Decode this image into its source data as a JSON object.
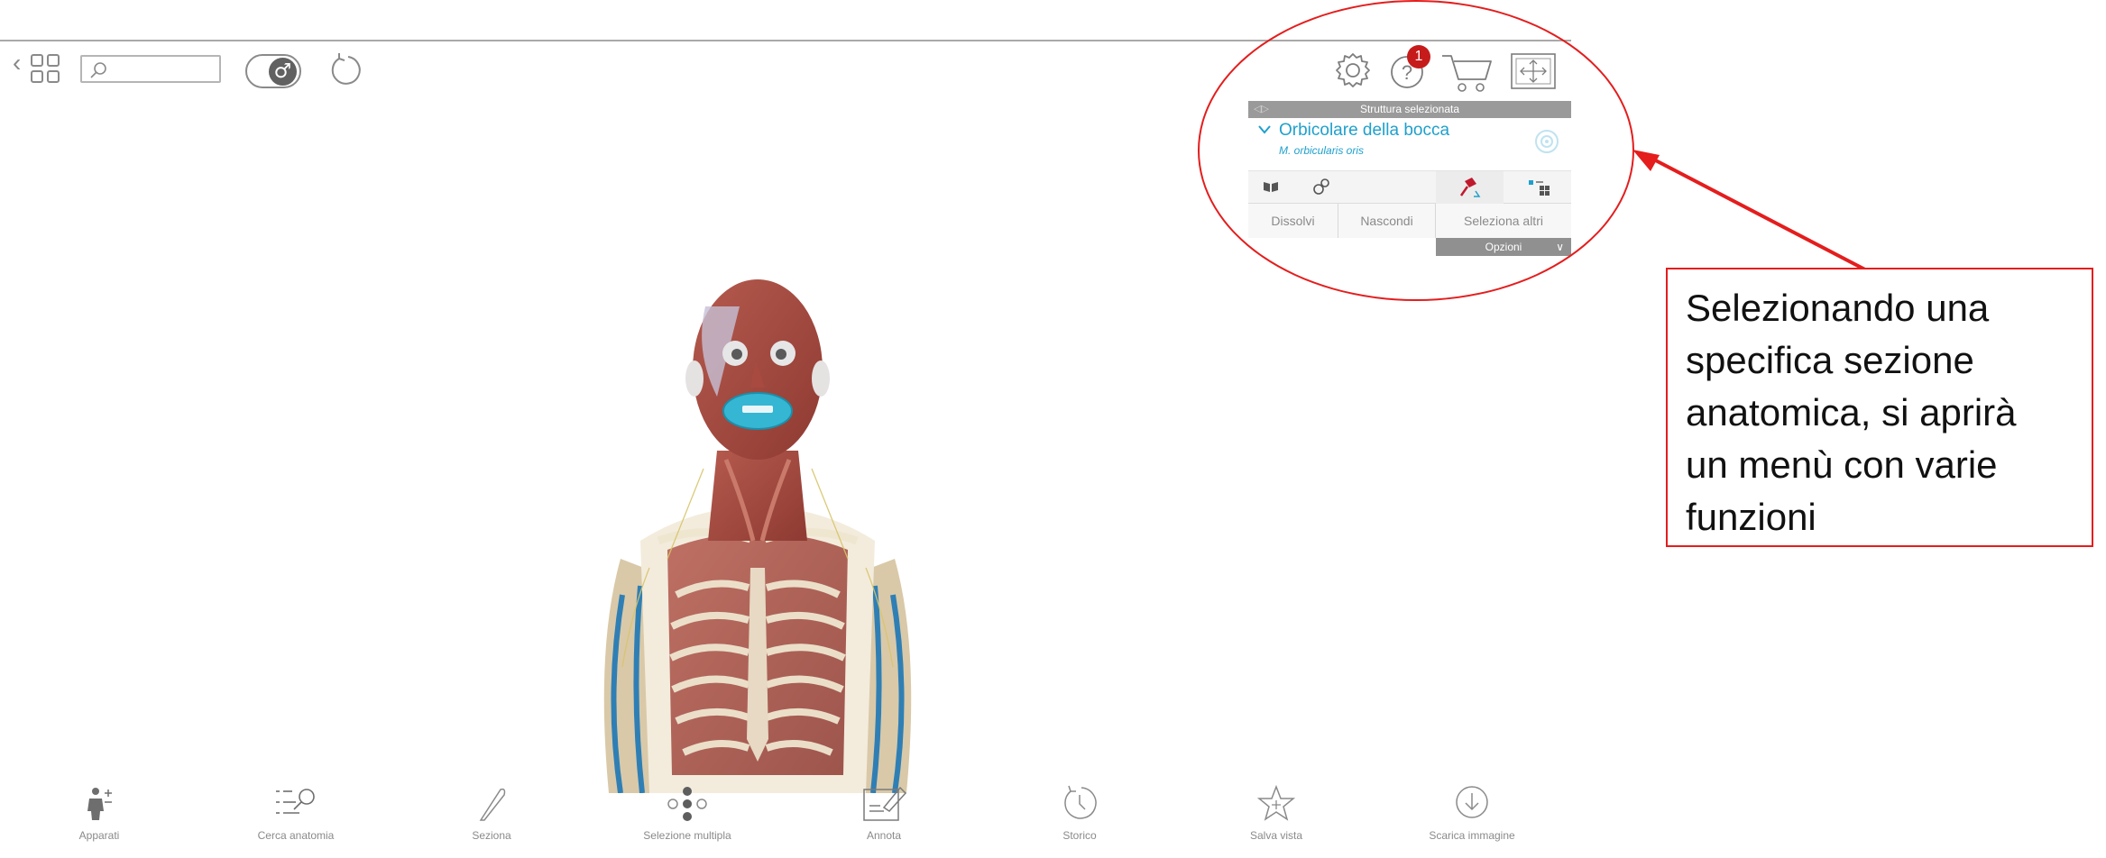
{
  "toolbar": {
    "back_icon": "chevron-left-icon",
    "grid_icon": "grid-icon",
    "search": {
      "value": "",
      "placeholder": ""
    },
    "gender_symbol": "♂",
    "reset_icon": "rotate-icon"
  },
  "top_right": {
    "settings_icon": "gear-icon",
    "help_icon": "help-icon",
    "help_badge": "1",
    "cart_icon": "cart-icon",
    "fullscreen_icon": "fullscreen-icon"
  },
  "selection_panel": {
    "header": "Struttura selezionata",
    "structure_name": "Orbicolare della bocca",
    "latin_name": "M. orbicularis oris",
    "buttons": [
      "Dissolvi",
      "Nascondi",
      "Seleziona altri"
    ],
    "options_label": "Opzioni"
  },
  "callout": {
    "lines": [
      "Selezionando una",
      "specifica sezione",
      "anatomica, si aprirà",
      "un menù con varie",
      "funzioni"
    ]
  },
  "bottom_toolbar": [
    {
      "label": "Apparati",
      "icon": "body-systems-icon"
    },
    {
      "label": "Cerca anatomia",
      "icon": "search-list-icon"
    },
    {
      "label": "Seziona",
      "icon": "scalpel-icon"
    },
    {
      "label": "Selezione multipla",
      "icon": "multi-select-icon"
    },
    {
      "label": "Annota",
      "icon": "annotate-icon"
    },
    {
      "label": "Storico",
      "icon": "history-icon"
    },
    {
      "label": "Salva vista",
      "icon": "star-icon"
    },
    {
      "label": "Scarica immagine",
      "icon": "download-icon"
    }
  ],
  "colors": {
    "accent": "#1fa0cc",
    "highlight": "#e41d1d",
    "badge": "#c61b1b",
    "panel_header": "#9a9a9a"
  }
}
